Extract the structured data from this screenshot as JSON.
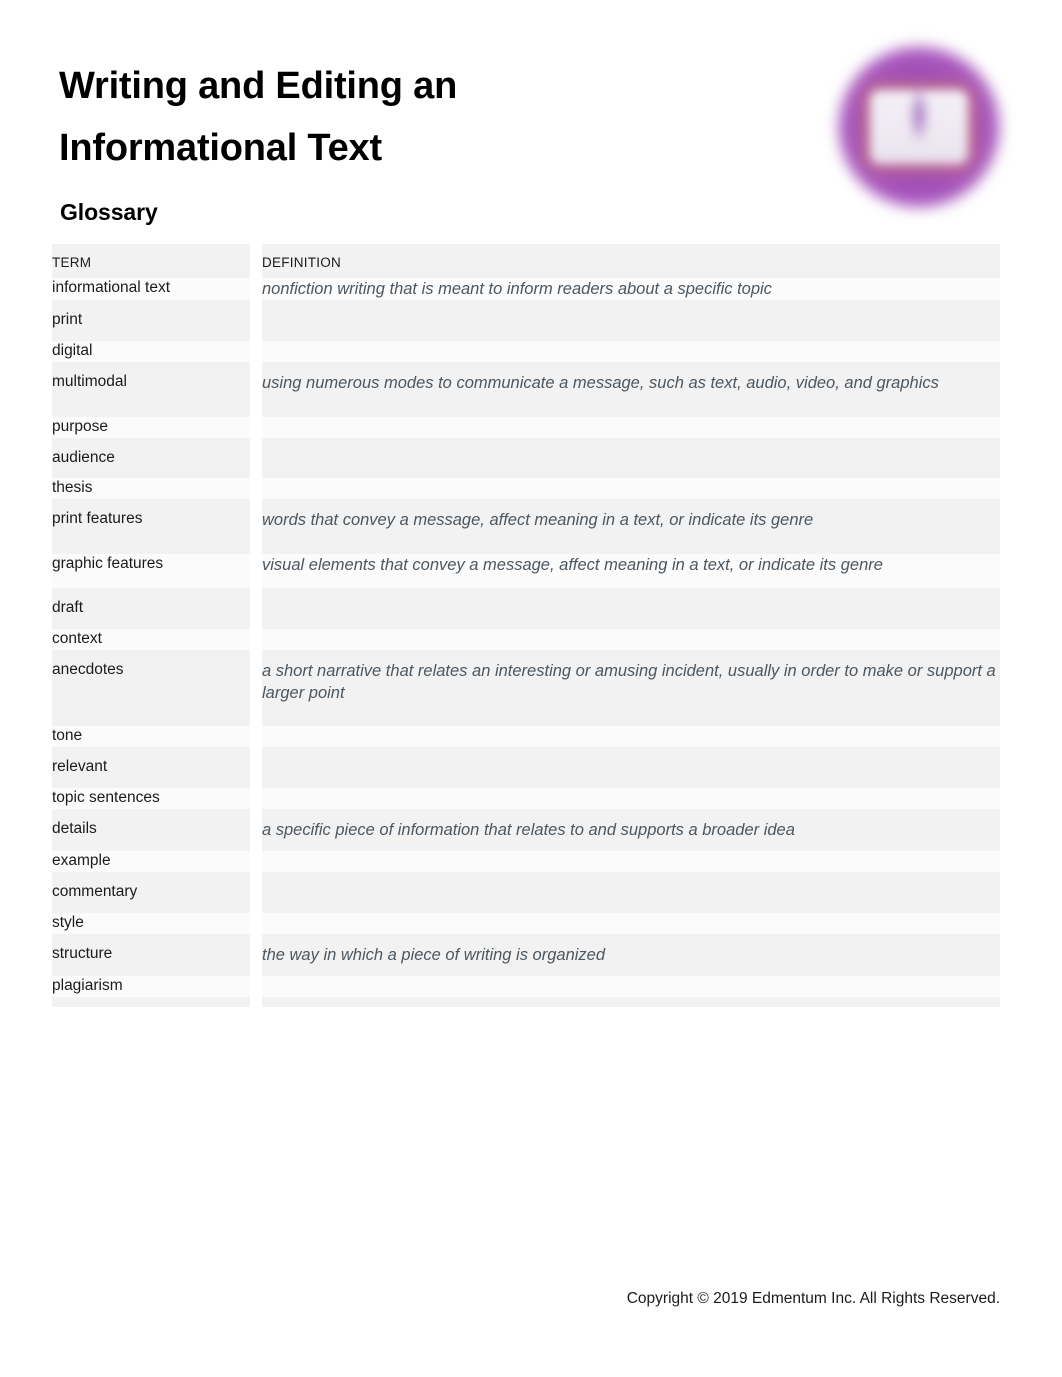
{
  "document": {
    "title": "Writing and Editing an\nInformational Text",
    "section_heading": "Glossary",
    "footer": "Copyright © 2019 Edmentum Inc. All Rights Reserved."
  },
  "logo": {
    "name": "edmentum-book-logo",
    "circle_color": "#9b49b5",
    "book_glow_color": "#e28c60"
  },
  "glossary": {
    "columns": [
      "TERM",
      "DEFINITION"
    ],
    "rows": [
      {
        "term": "informational text",
        "definition": "nonfiction writing that is meant to inform readers about a specific topic"
      },
      {
        "term": "print",
        "definition": ""
      },
      {
        "term": "digital",
        "definition": ""
      },
      {
        "term": "multimodal",
        "definition": "using numerous modes to communicate a message, such as text, audio, video, and graphics"
      },
      {
        "term": "purpose",
        "definition": ""
      },
      {
        "term": "audience",
        "definition": ""
      },
      {
        "term": "thesis",
        "definition": ""
      },
      {
        "term": "print features",
        "definition": "words that convey a message, affect meaning in a text, or indicate its genre"
      },
      {
        "term": "graphic features",
        "definition": "visual elements that convey a message, affect meaning in a text, or indicate its genre"
      },
      {
        "term": "draft",
        "definition": ""
      },
      {
        "term": "context",
        "definition": ""
      },
      {
        "term": "anecdotes",
        "definition": "a short narrative that relates an interesting or amusing incident, usually in order to make or support a larger point"
      },
      {
        "term": "tone",
        "definition": ""
      },
      {
        "term": "relevant",
        "definition": ""
      },
      {
        "term": "topic sentences",
        "definition": ""
      },
      {
        "term": "details",
        "definition": "a specific piece of information that relates to and supports a broader idea"
      },
      {
        "term": "example",
        "definition": ""
      },
      {
        "term": "commentary",
        "definition": ""
      },
      {
        "term": "style",
        "definition": ""
      },
      {
        "term": "structure",
        "definition": "the way in which a piece of writing is organized"
      },
      {
        "term": "plagiarism",
        "definition": ""
      }
    ]
  }
}
